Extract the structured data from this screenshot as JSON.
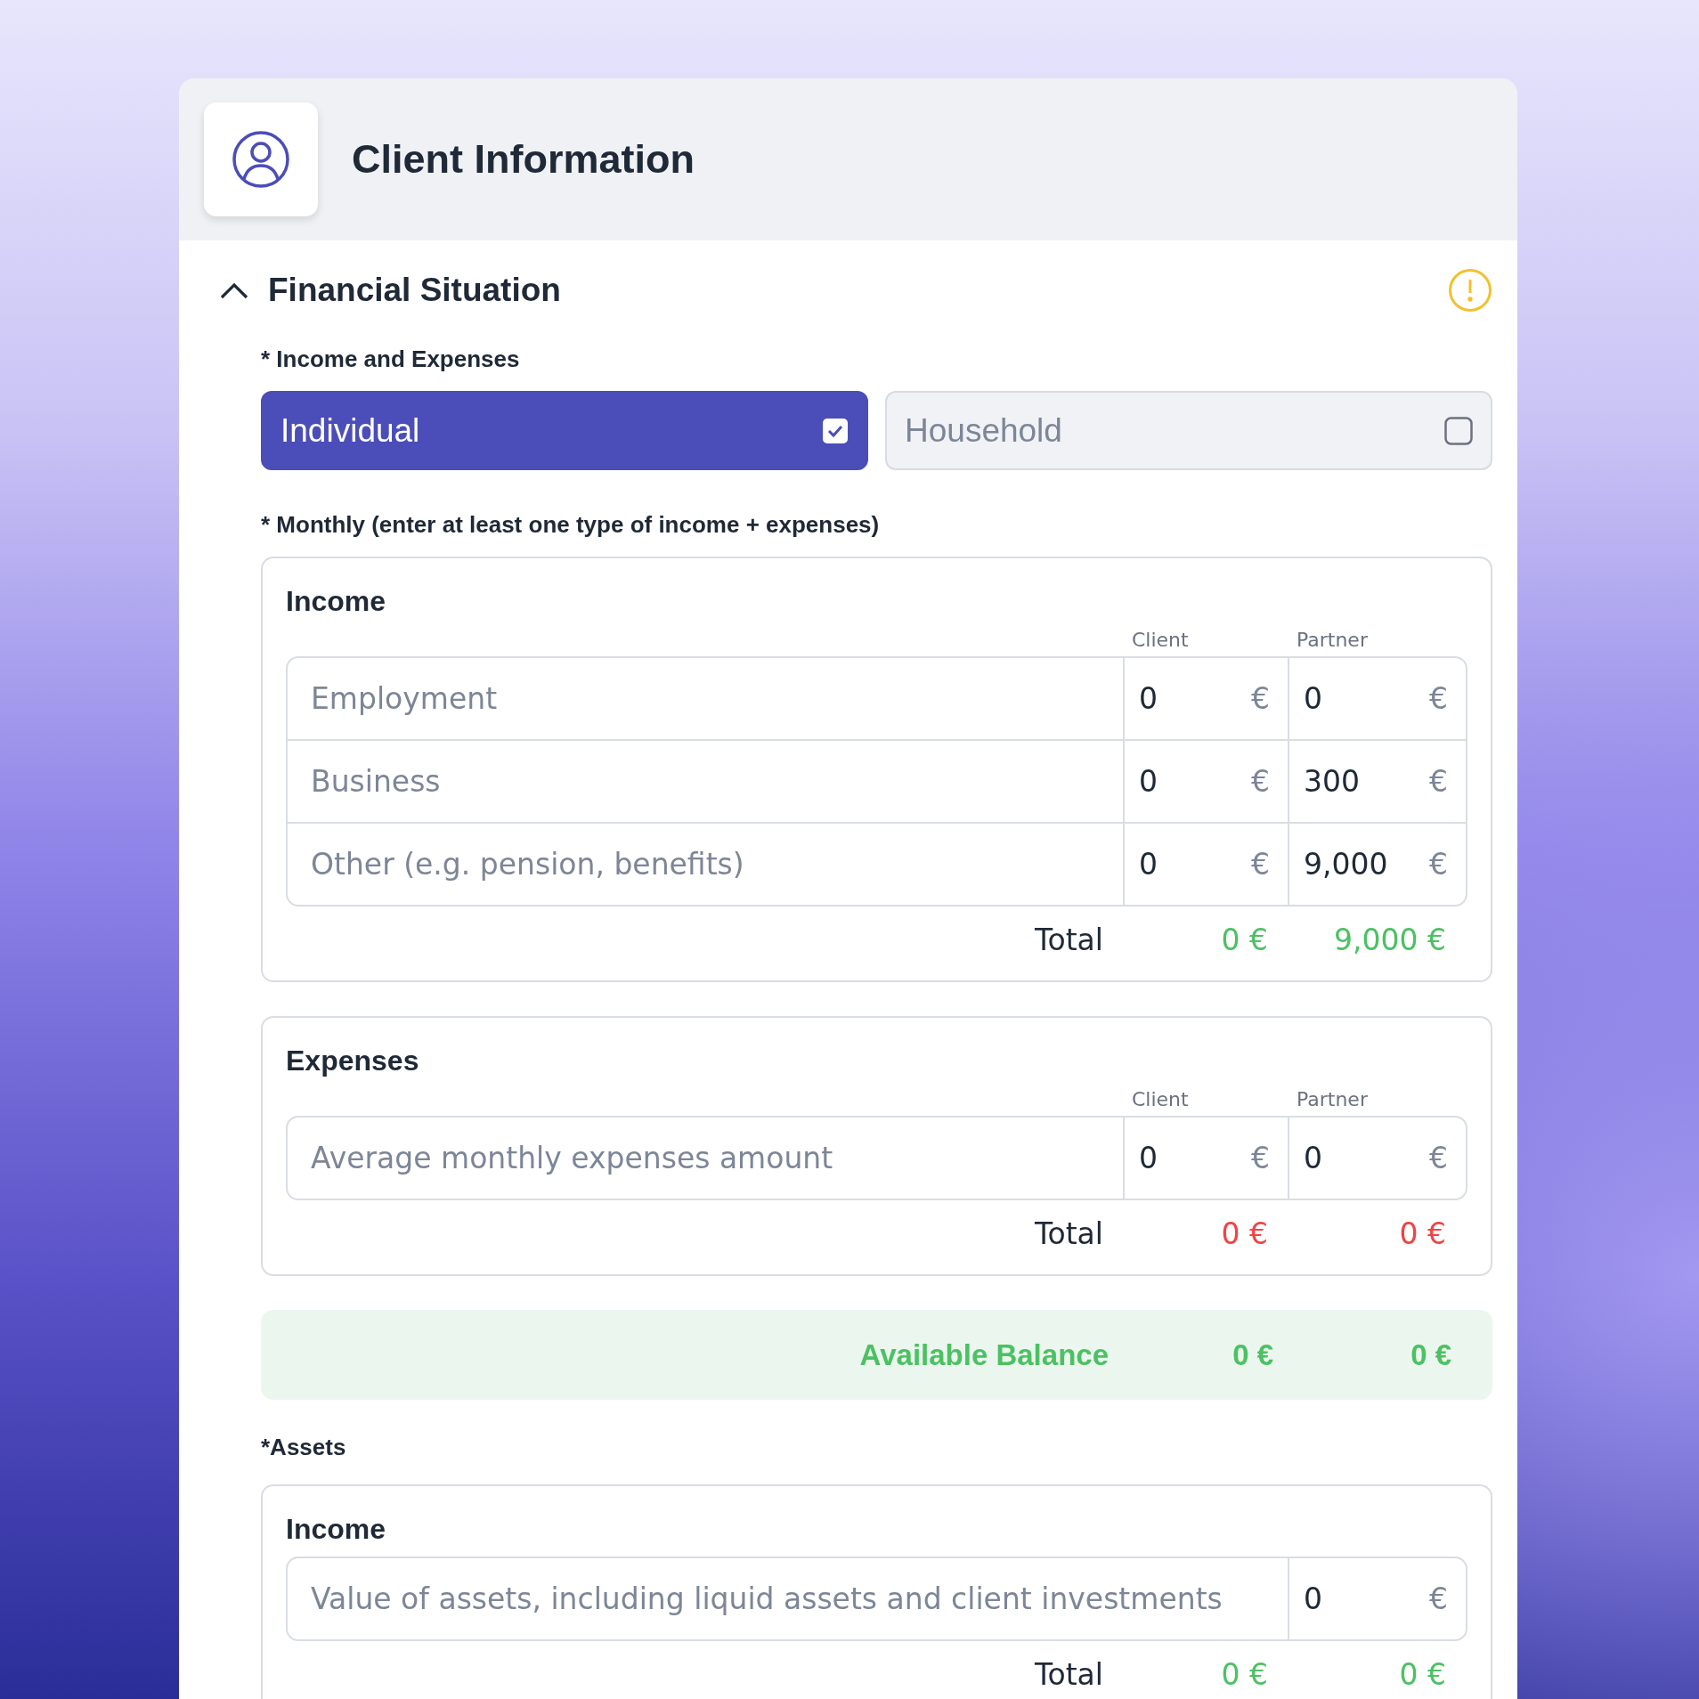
{
  "header": {
    "title": "Client Information"
  },
  "section": {
    "title": "Financial Situation",
    "expanded": true,
    "warning": true
  },
  "income_expenses": {
    "label": "* Income and Expenses",
    "options": [
      {
        "label": "Individual",
        "selected": true
      },
      {
        "label": "Household",
        "selected": false
      }
    ]
  },
  "monthly_label": "* Monthly (enter at least one type of income + expenses)",
  "cards": [
    {
      "kind": "income",
      "title": "Income",
      "columns": [
        "Client",
        "Partner"
      ],
      "rows": [
        {
          "label": "Employment",
          "values": [
            {
              "value": "0",
              "unit": "€"
            },
            {
              "value": "0",
              "unit": "€"
            }
          ]
        },
        {
          "label": "Business",
          "values": [
            {
              "value": "0",
              "unit": "€"
            },
            {
              "value": "300",
              "unit": "€"
            }
          ]
        },
        {
          "label": "Other (e.g. pension, benefits)",
          "values": [
            {
              "value": "0",
              "unit": "€"
            },
            {
              "value": "9,000",
              "unit": "€"
            }
          ]
        }
      ],
      "total": {
        "label": "Total",
        "values": [
          "0 €",
          "9,000 €"
        ]
      }
    },
    {
      "kind": "expense",
      "title": "Expenses",
      "columns": [
        "Client",
        "Partner"
      ],
      "rows": [
        {
          "label": "Average monthly expenses amount",
          "values": [
            {
              "value": "0",
              "unit": "€"
            },
            {
              "value": "0",
              "unit": "€"
            }
          ]
        }
      ],
      "total": {
        "label": "Total",
        "values": [
          "0 €",
          "0 €"
        ]
      }
    }
  ],
  "balance": {
    "label": "Available Balance",
    "values": [
      "0 €",
      "0 €"
    ]
  },
  "assets_label": "*Assets",
  "assets": {
    "kind": "income",
    "title": "Income",
    "rows": [
      {
        "label": "Value of assets, including liquid assets and client investments",
        "values": [
          {
            "value": "0",
            "unit": "€"
          }
        ]
      }
    ],
    "total": {
      "label": "Total",
      "values": [
        "0 €",
        "0 €"
      ]
    }
  }
}
